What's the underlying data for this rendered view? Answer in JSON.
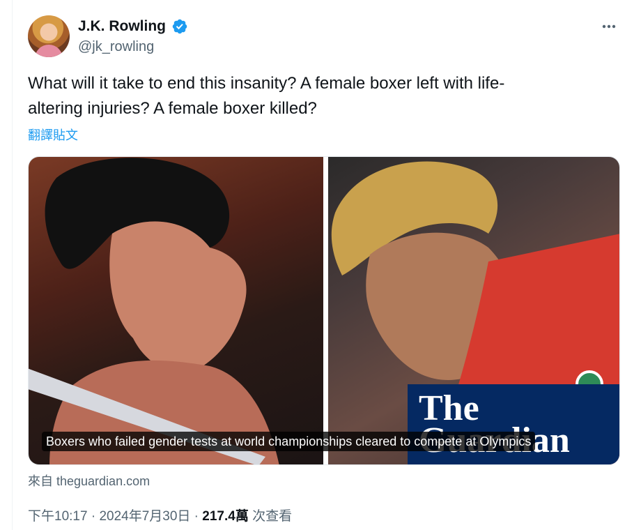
{
  "author": {
    "display_name": "J.K. Rowling",
    "handle": "@jk_rowling",
    "verified_icon": "verified-badge-icon",
    "verified_color": "#1d9bf0"
  },
  "tweet": {
    "text_line1": "What will it take to end this insanity? A  female boxer left with life-",
    "text_line2": "altering injuries? A female boxer killed?",
    "translate_label": "翻譯貼文"
  },
  "card": {
    "caption": "Boxers who failed gender tests at world championships cleared to compete at Olympics",
    "brand_line1": "The",
    "brand_line2": "Guardian",
    "brand_color": "#052962",
    "source": "來自 theguardian.com"
  },
  "meta": {
    "time": "下午10:17",
    "separator1": " · ",
    "date": "2024年7月30日",
    "separator2": " · ",
    "views_count": "217.4萬",
    "views_label": " 次查看"
  },
  "more_icon": "more-options-icon"
}
